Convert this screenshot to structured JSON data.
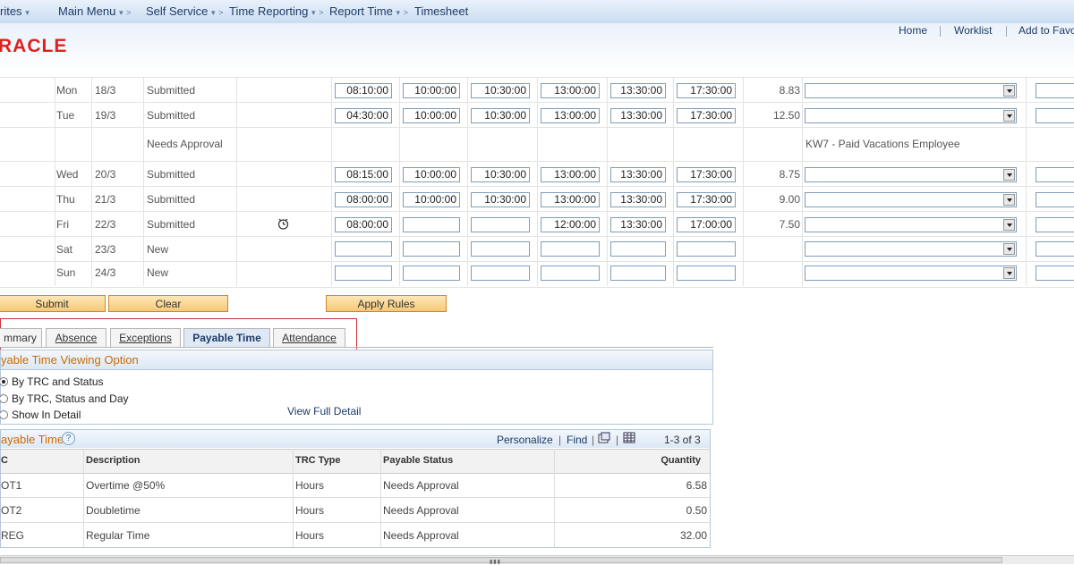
{
  "nav": {
    "items": [
      "rites",
      "Main Menu",
      "Self Service",
      "Time Reporting",
      "Report Time",
      "Timesheet"
    ]
  },
  "header": {
    "logo": "RACLE",
    "links": [
      "Home",
      "Worklist",
      "Add to Favo"
    ]
  },
  "timesheet": {
    "rows": [
      {
        "day": "Mon",
        "date": "18/3",
        "status": "Submitted",
        "times": [
          "08:10:00",
          "10:00:00",
          "10:30:00",
          "13:00:00",
          "13:30:00",
          "17:30:00"
        ],
        "total": "8.83"
      },
      {
        "day": "Tue",
        "date": "19/3",
        "status": "Submitted",
        "times": [
          "04:30:00",
          "10:00:00",
          "10:30:00",
          "13:00:00",
          "13:30:00",
          "17:30:00"
        ],
        "total": "12.50"
      },
      {
        "day": "Wed",
        "date": "20/3",
        "status": "Submitted",
        "times": [
          "08:15:00",
          "10:00:00",
          "10:30:00",
          "13:00:00",
          "13:30:00",
          "17:30:00"
        ],
        "total": "8.75"
      },
      {
        "day": "Thu",
        "date": "21/3",
        "status": "Submitted",
        "times": [
          "08:00:00",
          "10:00:00",
          "10:30:00",
          "13:00:00",
          "13:30:00",
          "17:30:00"
        ],
        "total": "9.00"
      },
      {
        "day": "Fri",
        "date": "22/3",
        "status": "Submitted",
        "times": [
          "08:00:00",
          "",
          "",
          "12:00:00",
          "13:30:00",
          "17:00:00"
        ],
        "total": "7.50"
      },
      {
        "day": "Sat",
        "date": "23/3",
        "status": "New",
        "times": [
          "",
          "",
          "",
          "",
          "",
          ""
        ],
        "total": ""
      },
      {
        "day": "Sun",
        "date": "24/3",
        "status": "New",
        "times": [
          "",
          "",
          "",
          "",
          "",
          ""
        ],
        "total": ""
      }
    ],
    "approval_row": {
      "status": "Needs Approval",
      "trc": "KW7 - Paid Vacations Employee"
    }
  },
  "buttons": {
    "submit": "Submit",
    "clear": "Clear",
    "apply_rules": "Apply Rules"
  },
  "tabs": {
    "summary": "mmary",
    "absence": "Absence",
    "exceptions": "Exceptions",
    "payable": "Payable Time",
    "attendance": "Attendance"
  },
  "viewing": {
    "title": "yable Time Viewing Option",
    "opt1": "By TRC and Status",
    "opt2": "By TRC, Status and Day",
    "opt3": "Show In Detail",
    "full_detail": "View Full Detail"
  },
  "payable": {
    "title": "ayable Time",
    "help": "?",
    "personalize": "Personalize",
    "find": "Find",
    "sep": "|",
    "count": "1-3 of 3",
    "columns": {
      "trc": "C",
      "desc": "Description",
      "type": "TRC Type",
      "status": "Payable Status",
      "qty": "Quantity"
    },
    "rows": [
      {
        "trc": "OT1",
        "desc": "Overtime @50%",
        "type": "Hours",
        "status": "Needs Approval",
        "qty": "6.58"
      },
      {
        "trc": "OT2",
        "desc": "Doubletime",
        "type": "Hours",
        "status": "Needs Approval",
        "qty": "0.50"
      },
      {
        "trc": "REG",
        "desc": "Regular Time",
        "type": "Hours",
        "status": "Needs Approval",
        "qty": "32.00"
      }
    ]
  }
}
